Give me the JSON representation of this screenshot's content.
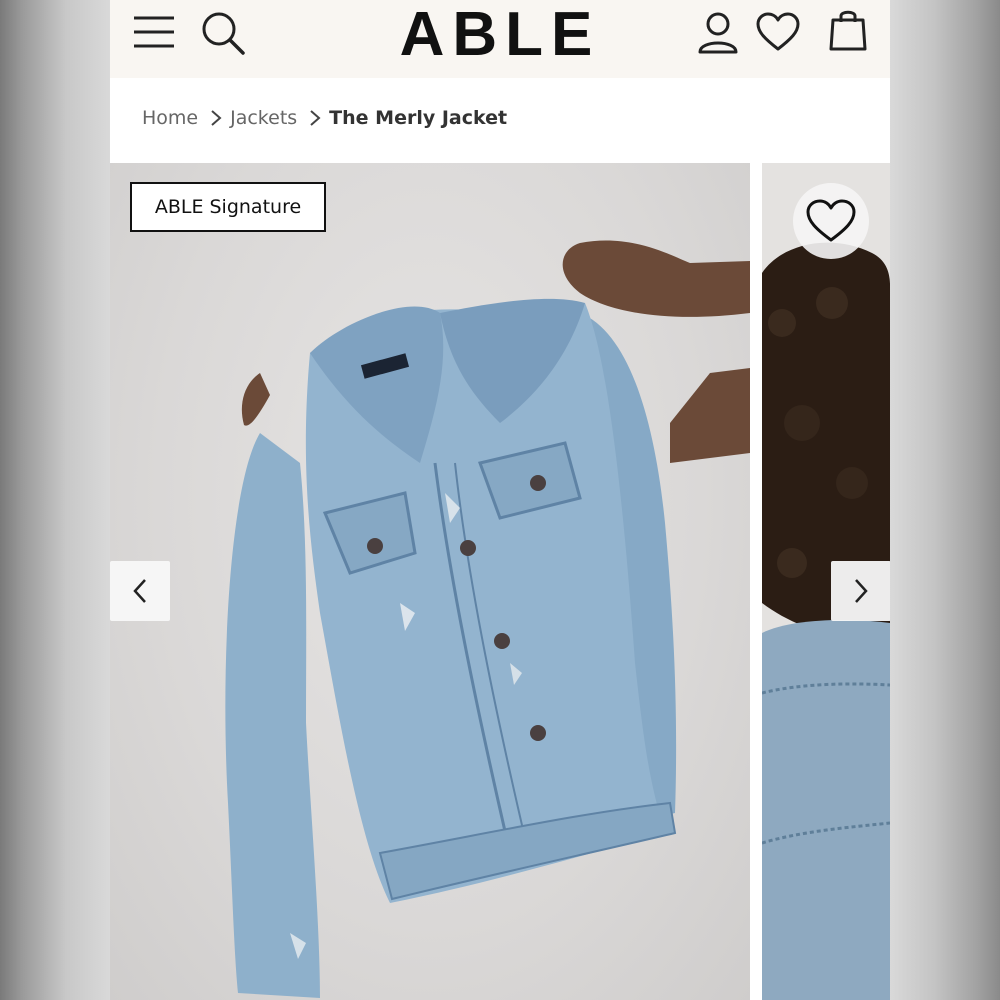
{
  "header": {
    "logo": "ABLE",
    "icons": [
      "menu-icon",
      "search-icon",
      "account-icon",
      "heart-icon",
      "bag-icon"
    ]
  },
  "breadcrumb": {
    "items": [
      "Home",
      "Jackets",
      "The Merly Jacket"
    ]
  },
  "product": {
    "badge": "ABLE Signature",
    "image_alt": "The Merly Jacket"
  },
  "gallery": {
    "prev_icon": "chevron-left-icon",
    "next_icon": "chevron-right-icon",
    "favorite_icon": "heart-outline-icon"
  },
  "colors": {
    "header_bg": "#f9f6f2",
    "denim": "#8fb0cc",
    "denim_dark": "#5f83a5",
    "text": "#111111"
  }
}
